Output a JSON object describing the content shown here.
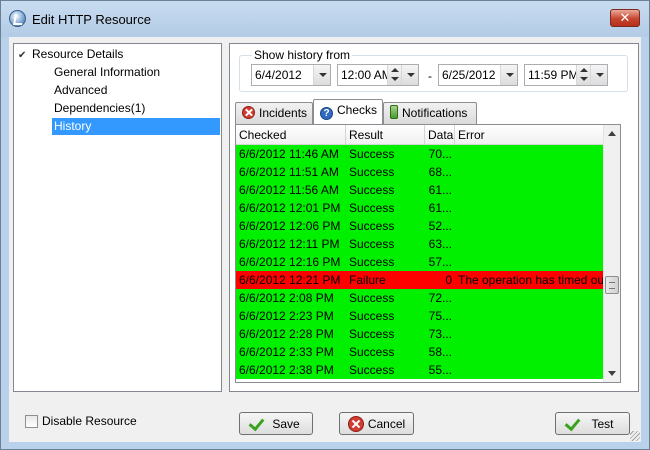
{
  "window": {
    "title": "Edit HTTP Resource",
    "close_glyph": "✕",
    "app_icon": "app-logo-icon"
  },
  "tree": {
    "root": "Resource Details",
    "items": [
      {
        "label": "General Information",
        "selected": false
      },
      {
        "label": "Advanced",
        "selected": false
      },
      {
        "label": "Dependencies(1)",
        "selected": false
      },
      {
        "label": "History",
        "selected": true
      }
    ]
  },
  "history": {
    "legend": "Show history from",
    "from_date": "6/4/2012",
    "from_time": "12:00 AM",
    "separator": "-",
    "to_date": "6/25/2012",
    "to_time": "11:59 PM"
  },
  "tabs": [
    {
      "label": "Incidents",
      "icon": "error-icon",
      "active": false
    },
    {
      "label": "Checks",
      "icon": "question-icon",
      "active": true
    },
    {
      "label": "Notifications",
      "icon": "notification-icon",
      "active": false
    }
  ],
  "grid": {
    "columns": [
      "Checked",
      "Result",
      "Data",
      "Error"
    ],
    "rows": [
      {
        "checked": "6/6/2012 11:46 AM",
        "result": "Success",
        "data": "70...",
        "error": "",
        "status": "success"
      },
      {
        "checked": "6/6/2012 11:51 AM",
        "result": "Success",
        "data": "68...",
        "error": "",
        "status": "success"
      },
      {
        "checked": "6/6/2012 11:56 AM",
        "result": "Success",
        "data": "61...",
        "error": "",
        "status": "success"
      },
      {
        "checked": "6/6/2012 12:01 PM",
        "result": "Success",
        "data": "61...",
        "error": "",
        "status": "success"
      },
      {
        "checked": "6/6/2012 12:06 PM",
        "result": "Success",
        "data": "52...",
        "error": "",
        "status": "success"
      },
      {
        "checked": "6/6/2012 12:11 PM",
        "result": "Success",
        "data": "63...",
        "error": "",
        "status": "success"
      },
      {
        "checked": "6/6/2012 12:16 PM",
        "result": "Success",
        "data": "57...",
        "error": "",
        "status": "success"
      },
      {
        "checked": "6/6/2012 12:21 PM",
        "result": "Failure",
        "data": "0",
        "error": "The operation has timed out",
        "status": "failure"
      },
      {
        "checked": "6/6/2012 2:08 PM",
        "result": "Success",
        "data": "72...",
        "error": "",
        "status": "success"
      },
      {
        "checked": "6/6/2012 2:23 PM",
        "result": "Success",
        "data": "75...",
        "error": "",
        "status": "success"
      },
      {
        "checked": "6/6/2012 2:28 PM",
        "result": "Success",
        "data": "73...",
        "error": "",
        "status": "success"
      },
      {
        "checked": "6/6/2012 2:33 PM",
        "result": "Success",
        "data": "58...",
        "error": "",
        "status": "success"
      },
      {
        "checked": "6/6/2012 2:38 PM",
        "result": "Success",
        "data": "55...",
        "error": "",
        "status": "success"
      }
    ]
  },
  "footer": {
    "disable_label": "Disable Resource",
    "disable_checked": false,
    "save_label": "Save",
    "cancel_label": "Cancel",
    "test_label": "Test"
  },
  "colors": {
    "success_row": "#00f000",
    "failure_row": "#ff0000",
    "selection": "#3399ff"
  }
}
